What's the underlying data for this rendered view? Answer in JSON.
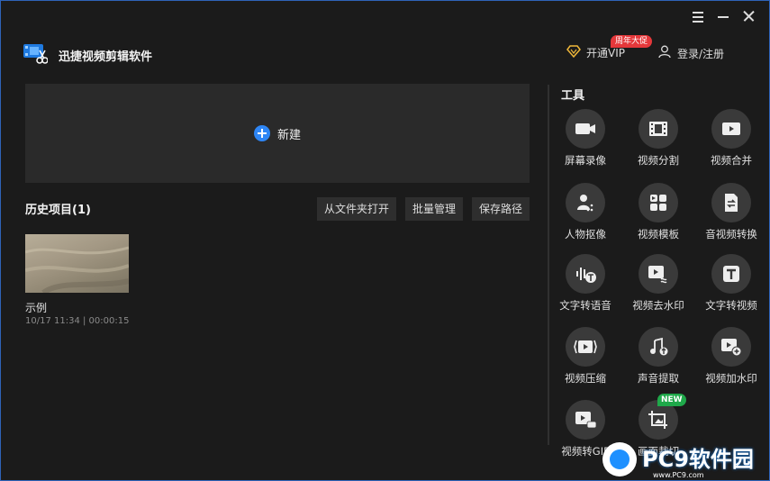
{
  "window": {
    "controls": {
      "menu": "menu-icon",
      "minimize": "minimize-icon",
      "close": "close-icon"
    }
  },
  "brand": {
    "title": "迅捷视频剪辑软件"
  },
  "header": {
    "vip_label": "开通VIP",
    "vip_badge": "周年大促",
    "login_label": "登录/注册"
  },
  "new_project": {
    "label": "新建"
  },
  "history": {
    "title": "历史项目(1)",
    "buttons": [
      "从文件夹打开",
      "批量管理",
      "保存路径"
    ],
    "items": [
      {
        "name": "示例",
        "meta": "10/17 11:34 | 00:00:15"
      }
    ]
  },
  "tools": {
    "title": "工具",
    "items": [
      {
        "label": "屏幕录像",
        "icon": "camera-icon"
      },
      {
        "label": "视频分割",
        "icon": "film-split-icon"
      },
      {
        "label": "视频合并",
        "icon": "play-merge-icon"
      },
      {
        "label": "人物抠像",
        "icon": "person-cutout-icon"
      },
      {
        "label": "视频模板",
        "icon": "template-icon"
      },
      {
        "label": "音视频转换",
        "icon": "file-convert-icon"
      },
      {
        "label": "文字转语音",
        "icon": "text-to-speech-icon"
      },
      {
        "label": "视频去水印",
        "icon": "remove-watermark-icon"
      },
      {
        "label": "文字转视频",
        "icon": "text-to-video-icon"
      },
      {
        "label": "视频压缩",
        "icon": "compress-icon"
      },
      {
        "label": "声音提取",
        "icon": "music-extract-icon"
      },
      {
        "label": "视频加水印",
        "icon": "add-watermark-icon"
      },
      {
        "label": "视频转GIF",
        "icon": "gif-icon"
      },
      {
        "label": "画面裁切",
        "icon": "crop-icon"
      }
    ],
    "new_badge": "NEW"
  },
  "watermark": {
    "text": "PC9软件园",
    "url": "www.PC9.com"
  },
  "colors": {
    "accent": "#2e86f5",
    "background": "#1b1b1b",
    "panel": "#2a2a2a",
    "badge_red": "#e5383b",
    "badge_green": "#1fa84a"
  }
}
